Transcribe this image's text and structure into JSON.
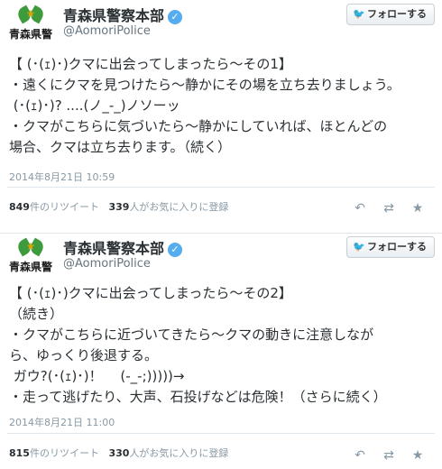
{
  "tweets": [
    {
      "account": {
        "name": "青森県警察本部",
        "handle": "@AomoriPolice",
        "avatar_text": "青森県警"
      },
      "follow_label": "フォローする",
      "text": "【 (･(ｪ)･)クマに出会ってしまったら〜その1】\n・遠くにクマを見つけたら〜静かにその場を立ち去りましょう。\n (･(ｪ)･)? ....(ノ_-_)ノソーッ\n・クマがこちらに気づいたら〜静かにしていれば、ほとんどの\n場合、クマは立ち去ります。（続く）",
      "timestamp": "2014年8月21日 10:59",
      "retweets": "849",
      "retweets_suffix": "件のリツイート",
      "favorites": "339",
      "favorites_suffix": "人がお気に入りに登録"
    },
    {
      "account": {
        "name": "青森県警察本部",
        "handle": "@AomoriPolice",
        "avatar_text": "青森県警"
      },
      "follow_label": "フォローする",
      "text": "【 (･(ｪ)･)クマに出会ってしまったら〜その2】\n（続き）\n・クマがこちらに近づいてきたら〜クマの動きに注意しなが\nら、ゆっくり後退する。\n ガウ?(･(ｪ)･)！　 (-_-;)))))→\n・走って逃げたり、大声、石投げなどは危険！（さらに続く）",
      "timestamp": "2014年8月21日 11:00",
      "retweets": "815",
      "retweets_suffix": "件のリツイート",
      "favorites": "330",
      "favorites_suffix": "人がお気に入りに登録"
    }
  ],
  "icons": {
    "verified": "verified-check-icon",
    "bird": "twitter-bird-icon",
    "reply": "reply-icon",
    "retweet": "retweet-icon",
    "favorite": "star-icon"
  },
  "colors": {
    "accent": "#55acee",
    "muted": "#8899a6"
  }
}
